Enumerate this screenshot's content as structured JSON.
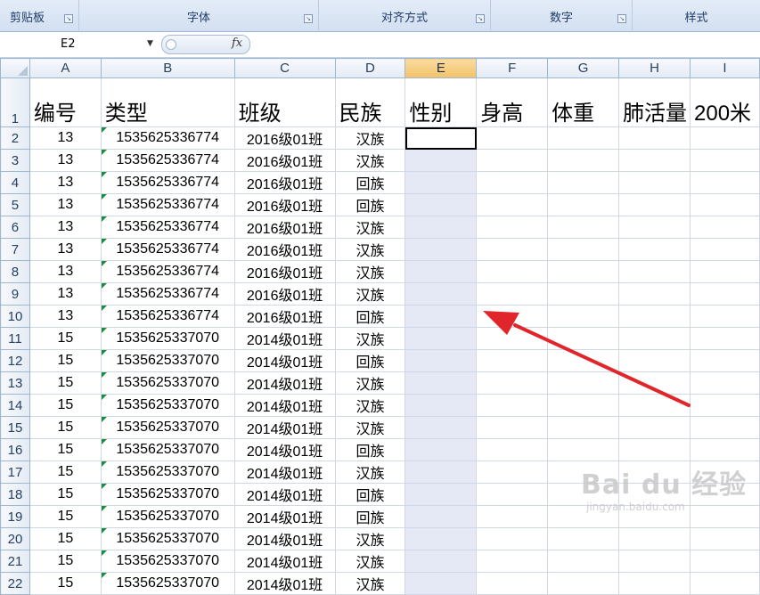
{
  "ribbon": {
    "groups": [
      {
        "label": "剪贴板"
      },
      {
        "label": "字体"
      },
      {
        "label": "对齐方式"
      },
      {
        "label": "数字"
      },
      {
        "label": "样式"
      }
    ]
  },
  "formula_bar": {
    "name_box": "E2",
    "fx_symbol": "fx",
    "formula": ""
  },
  "columns": [
    "A",
    "B",
    "C",
    "D",
    "E",
    "F",
    "G",
    "H",
    "I"
  ],
  "selected_column": "E",
  "active_cell": "E2",
  "header_row": {
    "row_num": "1",
    "cells": [
      "编号",
      "类型",
      "班级",
      "民族",
      "性别",
      "身高",
      "体重",
      "肺活量",
      "200米"
    ]
  },
  "rows": [
    {
      "n": "2",
      "a": "13",
      "b": "1535625336774",
      "c": "2016级01班",
      "d": "汉族"
    },
    {
      "n": "3",
      "a": "13",
      "b": "1535625336774",
      "c": "2016级01班",
      "d": "汉族"
    },
    {
      "n": "4",
      "a": "13",
      "b": "1535625336774",
      "c": "2016级01班",
      "d": "回族"
    },
    {
      "n": "5",
      "a": "13",
      "b": "1535625336774",
      "c": "2016级01班",
      "d": "回族"
    },
    {
      "n": "6",
      "a": "13",
      "b": "1535625336774",
      "c": "2016级01班",
      "d": "汉族"
    },
    {
      "n": "7",
      "a": "13",
      "b": "1535625336774",
      "c": "2016级01班",
      "d": "汉族"
    },
    {
      "n": "8",
      "a": "13",
      "b": "1535625336774",
      "c": "2016级01班",
      "d": "汉族"
    },
    {
      "n": "9",
      "a": "13",
      "b": "1535625336774",
      "c": "2016级01班",
      "d": "汉族"
    },
    {
      "n": "10",
      "a": "13",
      "b": "1535625336774",
      "c": "2016级01班",
      "d": "回族"
    },
    {
      "n": "11",
      "a": "15",
      "b": "1535625337070",
      "c": "2014级01班",
      "d": "汉族"
    },
    {
      "n": "12",
      "a": "15",
      "b": "1535625337070",
      "c": "2014级01班",
      "d": "回族"
    },
    {
      "n": "13",
      "a": "15",
      "b": "1535625337070",
      "c": "2014级01班",
      "d": "汉族"
    },
    {
      "n": "14",
      "a": "15",
      "b": "1535625337070",
      "c": "2014级01班",
      "d": "汉族"
    },
    {
      "n": "15",
      "a": "15",
      "b": "1535625337070",
      "c": "2014级01班",
      "d": "汉族"
    },
    {
      "n": "16",
      "a": "15",
      "b": "1535625337070",
      "c": "2014级01班",
      "d": "回族"
    },
    {
      "n": "17",
      "a": "15",
      "b": "1535625337070",
      "c": "2014级01班",
      "d": "汉族"
    },
    {
      "n": "18",
      "a": "15",
      "b": "1535625337070",
      "c": "2014级01班",
      "d": "回族"
    },
    {
      "n": "19",
      "a": "15",
      "b": "1535625337070",
      "c": "2014级01班",
      "d": "回族"
    },
    {
      "n": "20",
      "a": "15",
      "b": "1535625337070",
      "c": "2014级01班",
      "d": "汉族"
    },
    {
      "n": "21",
      "a": "15",
      "b": "1535625337070",
      "c": "2014级01班",
      "d": "汉族"
    },
    {
      "n": "22",
      "a": "15",
      "b": "1535625337070",
      "c": "2014级01班",
      "d": "汉族"
    }
  ],
  "watermark": {
    "line1": "Bai du 经验",
    "line2": "jingyan.baidu.com"
  },
  "colors": {
    "arrow": "#e0252b",
    "selected_column_bg": "#e5e9f5",
    "column_header_selected": "#f3c26a",
    "text_flag": "#1e8a3d"
  },
  "icons": {
    "dialog_launcher": "dialog-launcher-icon",
    "name_box_dropdown": "chevron-down-icon",
    "annotation": "red-arrow"
  }
}
